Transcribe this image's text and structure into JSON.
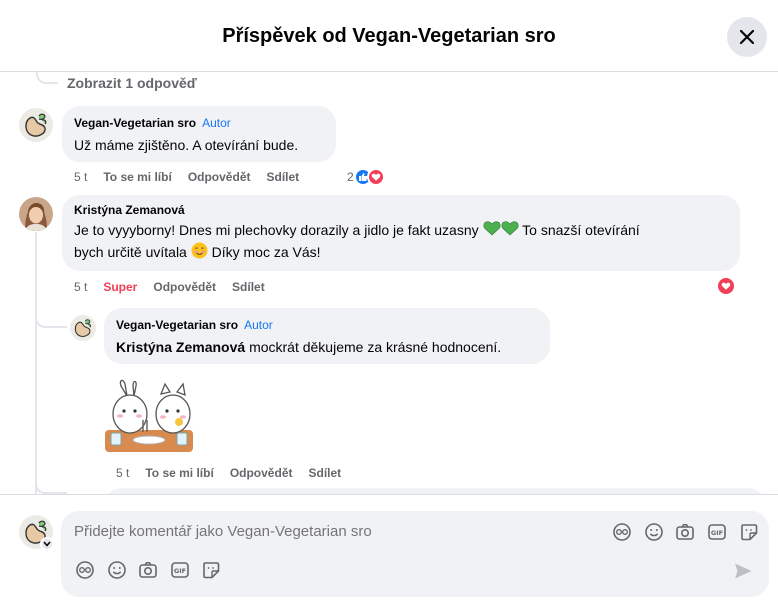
{
  "header": {
    "title": "Příspěvek od Vegan-Vegetarian sro"
  },
  "view_replies": "Zobrazit 1 odpověď",
  "comments": [
    {
      "author": "Vegan-Vegetarian sro",
      "badge": "Autor",
      "text": "Už máme zjištěno. A otevírání bude.",
      "time": "5 t",
      "like_label": "To se mi líbí",
      "reply_label": "Odpovědět",
      "share_label": "Sdílet",
      "reaction_count": "2"
    },
    {
      "author": "Kristýna Zemanová",
      "text_line1": "Je to vyyyborny! Dnes mi plechovky dorazily a jidlo je fakt uzasny",
      "text_line1_end": "To snazší otevírání",
      "text_line2a": "bych určitě uvítala",
      "text_line2b": "Díky moc za Vás!",
      "time": "5 t",
      "reaction_label": "Super",
      "reply_label": "Odpovědět",
      "share_label": "Sdílet"
    },
    {
      "author": "Vegan-Vegetarian sro",
      "badge": "Autor",
      "mention": "Kristýna Zemanová",
      "text": "mockrát děkujeme za krásné hodnocení.",
      "time": "5 t",
      "like_label": "To se mi líbí",
      "reply_label": "Odpovědět",
      "share_label": "Sdílet"
    }
  ],
  "composer": {
    "placeholder": "Přidejte komentář jako Vegan-Vegetarian sro"
  },
  "colors": {
    "accent": "#1877f2",
    "love": "#f33e58",
    "bubble": "#f0f2f5",
    "secondary_text": "#65676b"
  }
}
